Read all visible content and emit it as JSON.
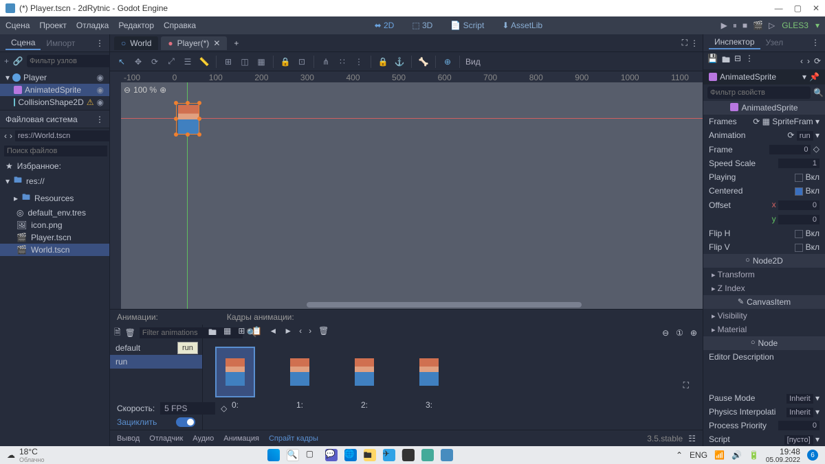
{
  "titlebar": {
    "title": "(*) Player.tscn - 2dRytnic - Godot Engine"
  },
  "menu": {
    "scene": "Сцена",
    "project": "Проект",
    "debug": "Отладка",
    "editor": "Редактор",
    "help": "Справка"
  },
  "modes": {
    "d2": "2D",
    "d3": "3D",
    "script": "Script",
    "assetlib": "AssetLib"
  },
  "renderer": "GLES3",
  "scene_panel": {
    "tab_scene": "Сцена",
    "tab_import": "Импорт",
    "filter_placeholder": "Фильтр узлов",
    "nodes": [
      {
        "name": "Player",
        "type": "player"
      },
      {
        "name": "AnimatedSprite",
        "type": "sprite"
      },
      {
        "name": "CollisionShape2D",
        "type": "collision"
      }
    ]
  },
  "fs_panel": {
    "title": "Файловая система",
    "path": "res://World.tscn",
    "search_placeholder": "Поиск файлов",
    "favorites": "Избранное:",
    "root": "res://",
    "items": [
      "Resources",
      "default_env.tres",
      "icon.png",
      "Player.tscn",
      "World.tscn"
    ]
  },
  "tabs": {
    "world": "World",
    "player": "Player(*)"
  },
  "viewport": {
    "zoom": "100 %",
    "view_btn": "Вид",
    "ruler_marks": [
      "-100",
      "0",
      "100",
      "200",
      "300",
      "400",
      "500",
      "600",
      "700",
      "800",
      "900",
      "1000",
      "1100"
    ]
  },
  "anim": {
    "animations_label": "Анимации:",
    "frames_label": "Кадры анимации:",
    "filter_placeholder": "Filter animations",
    "list": [
      "default",
      "run"
    ],
    "tooltip": "run",
    "frames": [
      "0:",
      "1:",
      "2:",
      "3:"
    ],
    "speed_label": "Скорость:",
    "speed_value": "5 FPS",
    "loop_label": "Зациклить"
  },
  "output": {
    "vyvod": "Вывод",
    "debugger": "Отладчик",
    "audio": "Аудио",
    "animation": "Анимация",
    "sprite_frames": "Спрайт кадры",
    "version": "3.5.stable"
  },
  "inspector": {
    "tab_inspector": "Инспектор",
    "tab_node": "Узел",
    "node_name": "AnimatedSprite",
    "filter_placeholder": "Фильтр свойств",
    "class_header": "AnimatedSprite",
    "frames_label": "Frames",
    "frames_value": "SpriteFram",
    "animation_label": "Animation",
    "animation_value": "run",
    "frame_label": "Frame",
    "frame_value": "0",
    "speedscale_label": "Speed Scale",
    "speedscale_value": "1",
    "playing_label": "Playing",
    "playing_on": "Вкл",
    "centered_label": "Centered",
    "centered_on": "Вкл",
    "offset_label": "Offset",
    "offset_x": "0",
    "offset_y": "0",
    "fliph_label": "Flip H",
    "fliph_on": "Вкл",
    "flipv_label": "Flip V",
    "flipv_on": "Вкл",
    "node2d": "Node2D",
    "transform": "Transform",
    "zindex": "Z Index",
    "canvasitem": "CanvasItem",
    "visibility": "Visibility",
    "material": "Material",
    "node": "Node",
    "editor_desc": "Editor Description",
    "pause_mode_label": "Pause Mode",
    "pause_mode_value": "Inherit",
    "physics_label": "Physics Interpolati",
    "physics_value": "Inherit",
    "priority_label": "Process Priority",
    "priority_value": "0",
    "script_label": "Script",
    "script_value": "[пусто]"
  },
  "taskbar": {
    "temp": "18°C",
    "weather": "Облачно",
    "lang": "ENG",
    "time": "19:48",
    "date": "05.09.2022",
    "notif": "6"
  }
}
